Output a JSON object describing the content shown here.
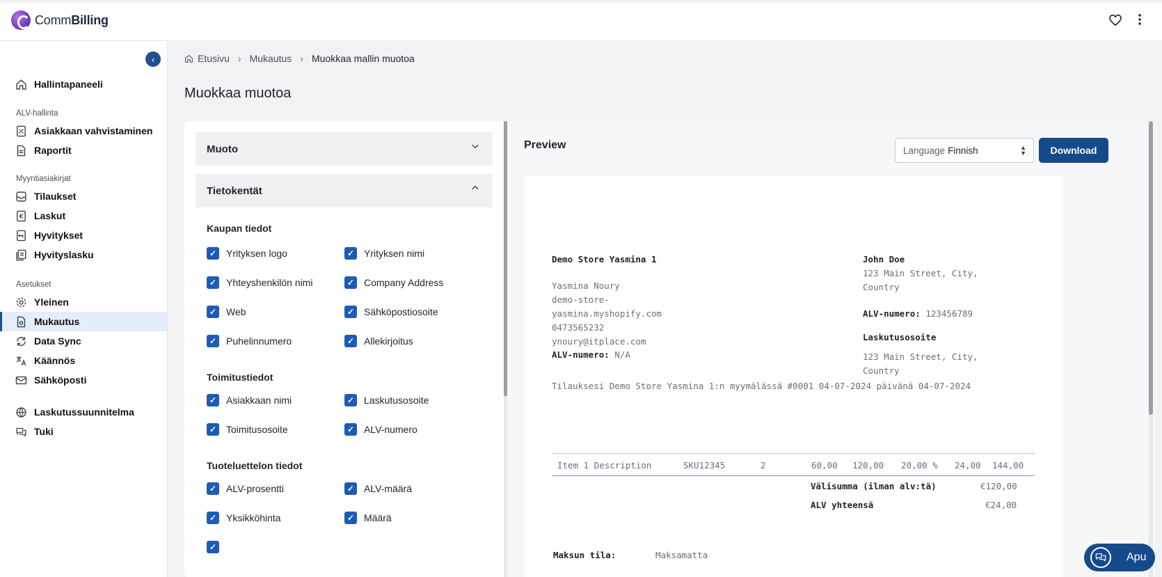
{
  "app": {
    "logo_regular": "Comm",
    "logo_bold": "Billing",
    "favorite_icon": "heart-icon",
    "menu_icon": "more-vertical-icon"
  },
  "sidebar": {
    "collapse_icon": "chevron-left-icon",
    "dashboard": "Hallintapaneeli",
    "section_vat": "ALV-hallinta",
    "customer_verification": "Asiakkaan vahvistaminen",
    "reports": "Raportit",
    "section_sales": "Myyntiasiakirjat",
    "orders": "Tilaukset",
    "invoices": "Laskut",
    "refunds": "Hyvitykset",
    "credit_notes": "Hyvityslasku",
    "section_settings": "Asetukset",
    "general": "Yleinen",
    "customization": "Mukautus",
    "data_sync": "Data Sync",
    "translation": "Käännös",
    "email": "Sähköposti",
    "billing_plan": "Laskutussuunnitelma",
    "support": "Tuki"
  },
  "breadcrumb": {
    "home": "Etusivu",
    "parent": "Mukautus",
    "current": "Muokkaa mallin muotoa"
  },
  "page": {
    "title": "Muokkaa muotoa"
  },
  "form": {
    "accordion_format": "Muoto",
    "accordion_fields": "Tietokentät",
    "group_store": "Kaupan tiedot",
    "store_fields": [
      "Yrityksen logo",
      "Yrityksen nimi",
      "Yhteyshenkilön nimi",
      "Company Address",
      "Web",
      "Sähköpostiosoite",
      "Puhelinnumero",
      "Allekirjoitus"
    ],
    "group_delivery": "Toimitustiedot",
    "delivery_fields": [
      "Asiakkaan nimi",
      "Laskutusosoite",
      "Toimitusosoite",
      "ALV-numero"
    ],
    "group_items": "Tuoteluettelon tiedot",
    "item_fields": [
      "ALV-prosentti",
      "ALV-määrä",
      "Yksikköhinta",
      "Määrä"
    ]
  },
  "preview": {
    "title": "Preview",
    "language_label": "Language",
    "language_value": "Finnish",
    "download": "Download"
  },
  "invoice": {
    "store_name": "Demo Store Yasmina 1",
    "store_contact": "Yasmina Noury",
    "store_web_1": "demo-store-",
    "store_web_2": "yasmina.myshopify.com",
    "store_phone": "0473565232",
    "store_email": "ynoury@itplace.com",
    "vat_label": "ALV-numero:",
    "store_vat": "N/A",
    "customer_name": "John Doe",
    "customer_address_1": "123 Main Street, City,",
    "customer_address_2": "Country",
    "customer_vat": "123456789",
    "billing_title": "Laskutusosoite",
    "billing_address_1": "123 Main Street, City,",
    "billing_address_2": "Country",
    "order_line": "Tilauksesi Demo Store Yasmina 1:n myymälässä #0001 04-07-2024 päivänä 04-07-2024",
    "item": {
      "description": "Item 1 Description",
      "sku": "SKU12345",
      "qty": "2",
      "unit_price": "60,00",
      "net": "120,00",
      "vat_pct": "20,00 %",
      "vat_amount": "24,00",
      "total": "144,00"
    },
    "subtotal_label": "Välisumma (ilman alv:tä)",
    "subtotal_value": "€120,00",
    "vat_total_label": "ALV yhteensä",
    "vat_total_value": "€24,00",
    "payment_status_label": "Maksun tila:",
    "payment_status_value": "Maksamatta"
  },
  "help": {
    "label": "Apu",
    "icon": "chat-bubbles-icon"
  }
}
